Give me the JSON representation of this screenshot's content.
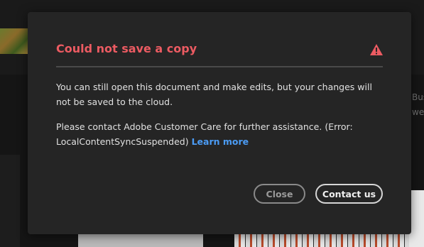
{
  "background": {
    "right_text": "Bus\nwee"
  },
  "dialog": {
    "title": "Could not save a copy",
    "title_color": "#ec5b62",
    "alert_icon": "alert-triangle-icon",
    "paragraph1": "You can still open this document and make edits, but your changes will not be saved to the cloud.",
    "paragraph2": "Please contact Adobe Customer Care for further assistance. (Error: LocalContentSyncSuspended)",
    "learn_more_label": "Learn more",
    "link_color": "#4b9cf5",
    "buttons": {
      "close_label": "Close",
      "contact_label": "Contact us"
    }
  }
}
